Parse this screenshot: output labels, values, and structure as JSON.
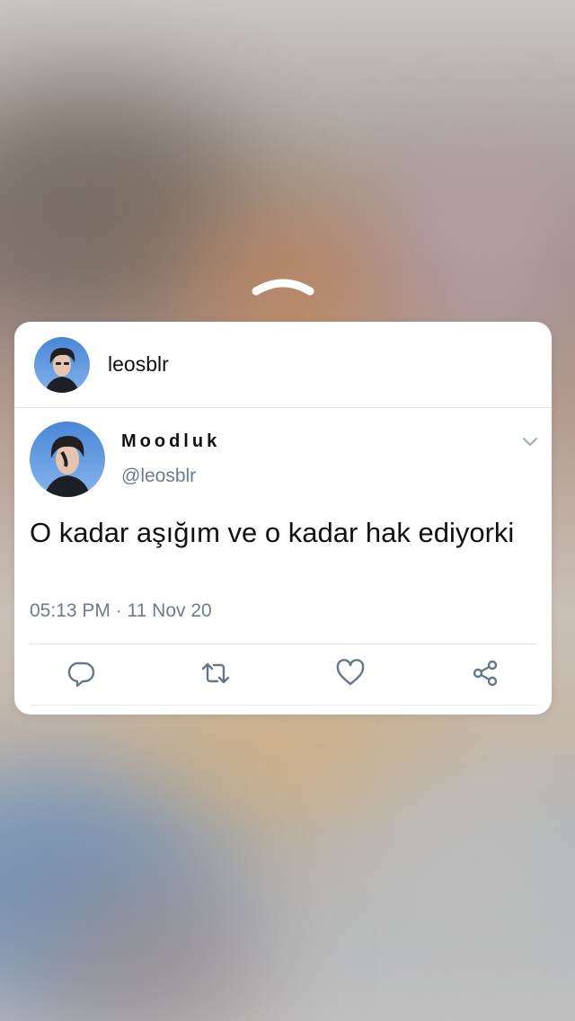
{
  "header": {
    "username": "leosblr"
  },
  "tweet": {
    "display_name": "Moodluk",
    "handle": "@leosblr",
    "text": "O kadar aşığım ve o kadar hak ediyorki",
    "timestamp": "05:13 PM · 11 Nov 20"
  },
  "icons": {
    "swipe_up": "chevron-up-icon",
    "menu": "chevron-down-icon",
    "reply": "reply-icon",
    "retweet": "retweet-icon",
    "like": "heart-icon",
    "share": "share-icon"
  },
  "colors": {
    "card_background": "#ffffff",
    "text_primary": "#111111",
    "text_secondary": "#6e7c88",
    "icon_color": "#657786"
  }
}
